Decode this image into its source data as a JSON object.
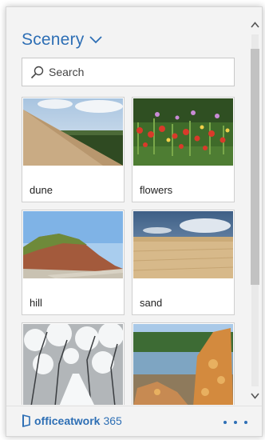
{
  "header": {
    "title": "Scenery"
  },
  "search": {
    "placeholder": "Search",
    "value": ""
  },
  "cards": [
    {
      "label": "dune"
    },
    {
      "label": "flowers"
    },
    {
      "label": "hill"
    },
    {
      "label": "sand"
    },
    {
      "label": ""
    },
    {
      "label": ""
    }
  ],
  "footer": {
    "brand_name": "officeatwork",
    "brand_suffix": "365"
  },
  "colors": {
    "accent": "#2e6fb5",
    "panel_bg": "#f3f3f3"
  }
}
